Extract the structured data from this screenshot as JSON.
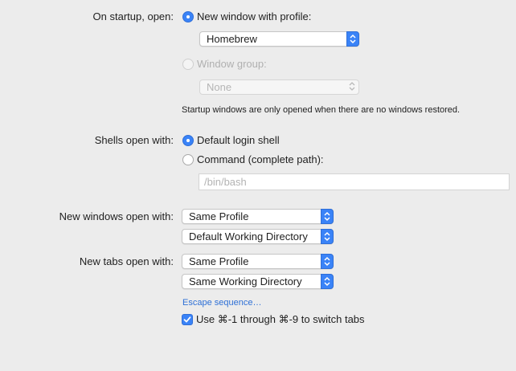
{
  "startup": {
    "label": "On startup, open:",
    "option_new_window": "New window with profile:",
    "profile_select": "Homebrew",
    "option_window_group": "Window group:",
    "window_group_select": "None",
    "note": "Startup windows are only opened when there are no windows restored."
  },
  "shells": {
    "label": "Shells open with:",
    "option_default": "Default login shell",
    "option_command": "Command (complete path):",
    "command_placeholder": "/bin/bash"
  },
  "new_windows": {
    "label": "New windows open with:",
    "profile_select": "Same Profile",
    "directory_select": "Default Working Directory"
  },
  "new_tabs": {
    "label": "New tabs open with:",
    "profile_select": "Same Profile",
    "directory_select": "Same Working Directory"
  },
  "escape_link": "Escape sequence…",
  "switch_tabs_checkbox": {
    "label": "Use ⌘-1 through ⌘-9 to switch tabs",
    "checked": true
  },
  "colors": {
    "accent": "#3a83f7",
    "link": "#2d6fd6"
  },
  "icons": {
    "stepper": "up-down-chevron-icon",
    "check": "checkmark-icon"
  }
}
